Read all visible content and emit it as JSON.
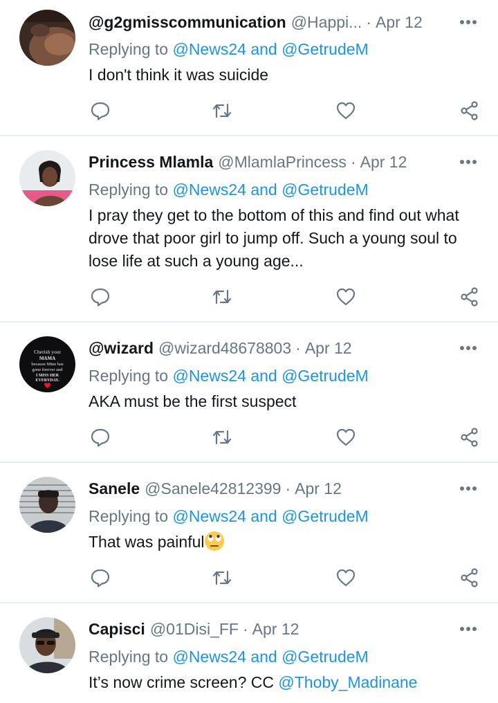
{
  "replying_label": "Replying to",
  "reply_targets": {
    "first": "@News24",
    "and": "and",
    "second": "@GetrudeM"
  },
  "colors": {
    "link": "#1b95e0",
    "muted": "#657786",
    "text": "#14171a",
    "divider": "#e6ecf0"
  },
  "icons": {
    "reply": "reply-icon",
    "retweet": "retweet-icon",
    "like": "like-icon",
    "share": "share-icon",
    "more": "more-icon"
  },
  "tweets": [
    {
      "name": "@g2gmisscommunication",
      "handle": "@Happi...",
      "date": "Apr 12",
      "text": "I don't think it was suicide"
    },
    {
      "name": "Princess Mlamla",
      "handle": "@MlamlaPrincess",
      "date": "Apr 12",
      "text": "I pray they get to the bottom of this and find out what drove that poor girl to jump off. Such a young soul to lose life at such a young age..."
    },
    {
      "name": "@wizard",
      "handle": "@wizard48678803",
      "date": "Apr 12",
      "text": "AKA must be the first suspect",
      "avatar_text": [
        "Cherish your",
        "MAMA",
        "because Mine has",
        "gone forever and",
        "I MISS HER",
        "EVERYDAY."
      ]
    },
    {
      "name": "Sanele",
      "handle": "@Sanele42812399",
      "date": "Apr 12",
      "text": "That was painful",
      "emoji": "face-with-rolling-eyes"
    },
    {
      "name": "Capisci",
      "handle": "@01Disi_FF",
      "date": "Apr 12",
      "text": "It’s now crime screen? CC ",
      "mention": "@Thoby_Madinane"
    }
  ]
}
